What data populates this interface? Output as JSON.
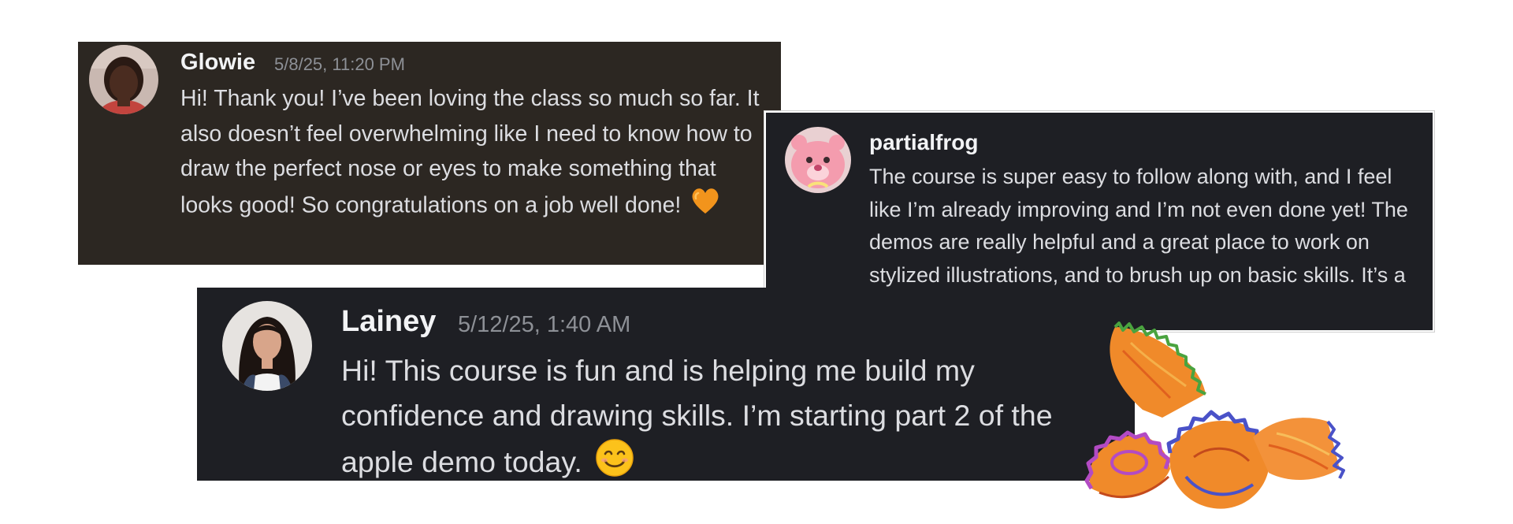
{
  "messages": [
    {
      "username": "Glowie",
      "timestamp": "5/8/25, 11:20 PM",
      "text": "Hi! Thank you! I’ve been loving the class so much so far. It also doesn’t feel overwhelming like I need to know how to draw the perfect nose or eyes to make something that looks good! So congratulations on a job well done!",
      "emoji_icon": "orange-heart-icon",
      "card_color": "#2c2722"
    },
    {
      "username": "partialfrog",
      "text": "The course is super easy to follow along with, and I feel like I’m already improving and I’m not even done yet! The demos are really helpful and a great place to work on stylized illustrations, and to brush up on basic skills. It’s a great investment!",
      "card_color": "#1e1f24"
    },
    {
      "username": "Lainey",
      "timestamp": "5/12/25, 1:40 AM",
      "text": "Hi! This course is fun and is helping me build my confidence and drawing skills. I’m starting part 2 of the apple demo today.",
      "emoji_icon": "smiling-face-icon",
      "card_color": "#1e1f24"
    }
  ],
  "decoration": "pencil-shavings-illustration"
}
